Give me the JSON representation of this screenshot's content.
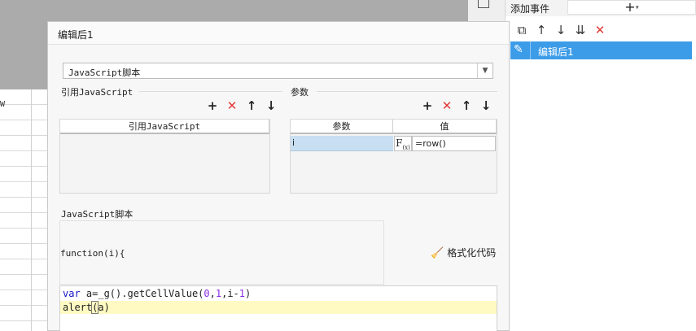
{
  "right_panel": {
    "add_event_label": "添加事件",
    "add_button": "+",
    "add_caret": "▾",
    "toolbar": [
      {
        "name": "copy-icon",
        "glyph": "⧉"
      },
      {
        "name": "move-up-icon",
        "glyph": "↑"
      },
      {
        "name": "move-down-icon",
        "glyph": "↓"
      },
      {
        "name": "sort-icon",
        "glyph": "⇊"
      },
      {
        "name": "delete-icon",
        "glyph": "✕"
      }
    ],
    "event_item_label": "编辑后1"
  },
  "dialog": {
    "title": "编辑后1",
    "type_select_value": "JavaScript脚本",
    "ref_js_section_title": "引用JavaScript",
    "ref_js_column_header": "引用JavaScript",
    "params_section_title": "参数",
    "params_columns": [
      "参数",
      "值"
    ],
    "params_rows": [
      {
        "name": "i",
        "value": "=row()"
      }
    ],
    "fx_label": "F",
    "fx_sub": "(x)",
    "script_section_title": "JavaScript脚本",
    "function_signature": "function(i){",
    "format_button_label": "格式化代码",
    "code": {
      "line1": {
        "kw": "var",
        "a": " a=_g().getCellValue(",
        "n1": "0",
        "c1": ",",
        "n2": "1",
        "rest": ",i-",
        "n3": "1",
        "end": ")"
      },
      "line2": {
        "pre": "alert",
        "paren": "(",
        "post": "a)"
      }
    }
  },
  "toolbar_icons": {
    "add": "+",
    "delete": "✕",
    "up": "↑",
    "down": "↓"
  },
  "background": {
    "grid_stub": "W"
  },
  "colors": {
    "accent": "#3d9ce8",
    "delete_red": "#e53935",
    "keyword": "#1414c8",
    "number": "#8a2be2",
    "line_highlight": "#fffac2"
  }
}
